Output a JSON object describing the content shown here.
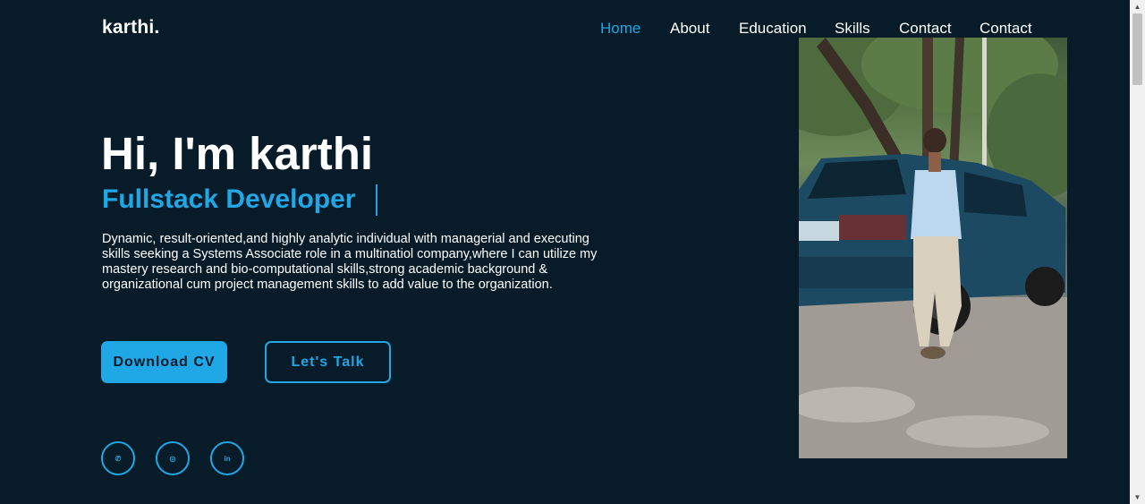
{
  "header": {
    "logo": "karthi.",
    "nav": [
      {
        "label": "Home",
        "active": true
      },
      {
        "label": "About",
        "active": false
      },
      {
        "label": "Education",
        "active": false
      },
      {
        "label": "Skills",
        "active": false
      },
      {
        "label": "Contact",
        "active": false
      },
      {
        "label": "Contact",
        "active": false
      }
    ]
  },
  "hero": {
    "title": "Hi, I'm karthi",
    "role": "Fullstack Developer",
    "bio": "Dynamic, result-oriented,and highly analytic individual with managerial and executing skills seeking a Systems Associate role in a multinatiol company,where I can utilize my mastery research and bio-computational skills,strong academic background & organizational cum project management skills to add value to the organization.",
    "buttons": {
      "download": "Download CV",
      "talk": "Let's Talk"
    },
    "social": [
      {
        "icon": "whatsapp-icon",
        "glyph": "✆"
      },
      {
        "icon": "instagram-icon",
        "glyph": "◎"
      },
      {
        "icon": "linkedin-icon",
        "glyph": "in"
      }
    ]
  },
  "colors": {
    "background": "#081b29",
    "accent": "#1fa7e6",
    "text": "#ffffff"
  }
}
